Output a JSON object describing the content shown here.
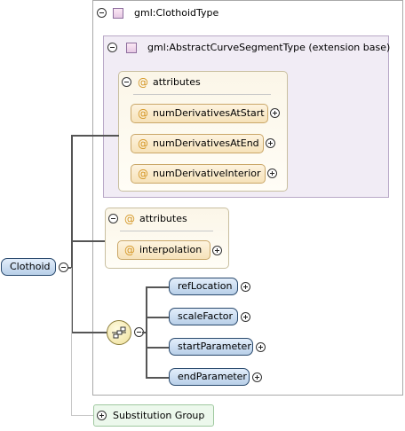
{
  "root": {
    "label": "Clothoid"
  },
  "clothoid_type": {
    "label": "gml:ClothoidType"
  },
  "extension": {
    "label": "gml:AbstractCurveSegmentType (extension base)"
  },
  "base_attributes": {
    "label": "attributes",
    "items": [
      "numDerivativesAtStart",
      "numDerivativesAtEnd",
      "numDerivativeInterior"
    ]
  },
  "own_attributes": {
    "label": "attributes",
    "items": [
      "interpolation"
    ]
  },
  "sequence": {
    "elements": [
      "refLocation",
      "scaleFactor",
      "startParameter",
      "endParameter"
    ]
  },
  "substitution_group": {
    "label": "Substitution Group"
  },
  "icons": {
    "attribute": "@"
  }
}
